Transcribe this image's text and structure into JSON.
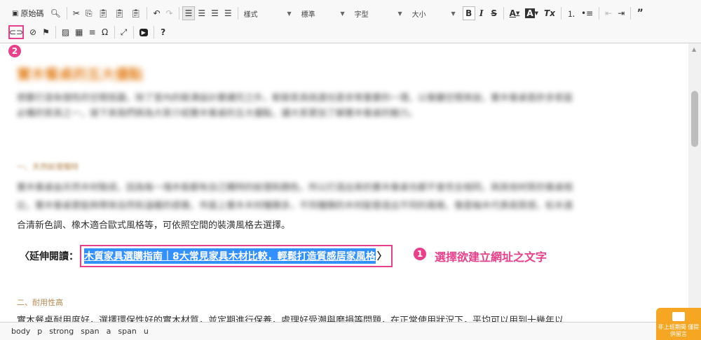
{
  "toolbar": {
    "source_label": "原始碼",
    "format_combo": "樣式",
    "normal_combo": "標準",
    "font_combo": "字型",
    "size_combo": "大小",
    "bold": "B",
    "italic": "I",
    "strike": "S",
    "font_color": "A",
    "bg_color": "A",
    "clear_format": "Tx",
    "blockquote": "99",
    "omega": "Ω",
    "help": "?"
  },
  "annotations": {
    "badge_1": "1",
    "badge_2": "2",
    "note": "選擇欲建立網址之文字"
  },
  "content": {
    "title": "實木餐桌的五大優點",
    "intro_line1": "想要打造有個性的空間氛圍，除了室內的裝潢設計要講究之外，軟裝家具挑選也是非常重要的一環，以餐廳空間來說，實木餐桌是許多家庭",
    "intro_line2": "必備的家具之一，接下來我們將為大家介紹實木餐桌的五大優點，讓大家更加了解實木餐桌的魅力。",
    "section1": "一、天然紋理獨特",
    "p1_line1": "實木餐桌由天然木材製成，因為每一塊木板都有自己獨特的紋理和顏色，所以打造出來的實木餐桌也都不會完全相同，與其他材質的餐桌相",
    "p1_line2": "比，實木餐桌更能夠帶來自然和溫暖的感覺。市面上實木木材種類多，不同種類的木材能營造出不同的風格，像是柚木代表高質感，松木適",
    "p1_line3": "合清新色調、橡木適合歐式風格等，可依照空間的裝潢風格去選擇。",
    "readmore_prefix": "〈延伸閱讀：",
    "readmore_link": "木質家具選購指南｜8大常見家具木材比較，輕鬆打造質感居家風格",
    "readmore_suffix": "〉",
    "section2": "二、耐用性高",
    "p2_line1": "實木餐桌耐用度好，選擇環保性好的實木材質，並定期進行保養，處理好受潮與磨損等問題，在正常使用狀況下，平均可以用到十幾年以"
  },
  "statusbar": {
    "path": [
      "body",
      "p",
      "strong",
      "span",
      "a",
      "span",
      "u"
    ]
  },
  "chat": {
    "label": "非上班期間 僅提供留言"
  }
}
